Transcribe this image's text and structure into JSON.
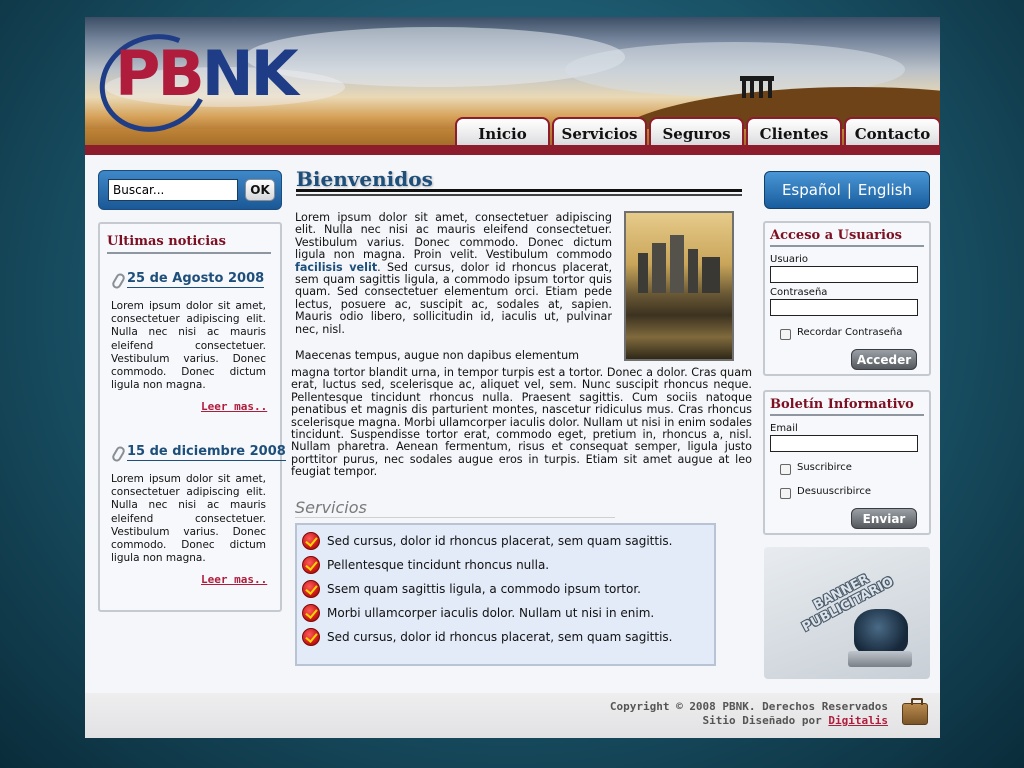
{
  "logo": {
    "text_p": "P",
    "text_b": "B",
    "text_n": "N",
    "text_k": "K"
  },
  "nav": [
    {
      "label": "Inicio"
    },
    {
      "label": "Servicios"
    },
    {
      "label": "Seguros"
    },
    {
      "label": "Clientes"
    },
    {
      "label": "Contacto"
    }
  ],
  "search": {
    "placeholder": "Buscar...",
    "value": "Buscar...",
    "button": "OK"
  },
  "news": {
    "title": "Ultimas noticias",
    "items": [
      {
        "date": "25 de Agosto 2008",
        "text": "Lorem ipsum dolor sit amet, consectetuer adipiscing elit. Nulla nec nisi ac mauris eleifend consectetuer. Vestibulum varius. Donec commodo. Donec dictum ligula non magna.",
        "more": "Leer mas.."
      },
      {
        "date": "15 de diciembre 2008",
        "text": "Lorem ipsum dolor sit amet, consectetuer adipiscing elit. Nulla nec nisi ac mauris eleifend consectetuer. Vestibulum varius. Donec commodo. Donec dictum ligula non magna.",
        "more": "Leer mas.."
      }
    ]
  },
  "main": {
    "title": "Bienvenidos",
    "para1_a": "Lorem ipsum dolor sit amet, consectetuer adipiscing elit. Nulla nec nisi ac mauris eleifend consectetuer. Vestibulum varius. Donec commodo. Donec dictum ligula non magna. Proin velit. Vestibulum commodo ",
    "para1_link": "facilisis velit",
    "para1_b": ". Sed cursus, dolor id rhoncus placerat, sem quam sagittis ligula, a commodo ipsum tortor quis quam. Sed consectetuer elementum orci. Etiam pede lectus, posuere ac, suscipit ac, sodales at, sapien. Mauris odio libero, sollicitudin id, iaculis ut, pulvinar nec, nisl.",
    "para2_a": "Maecenas tempus, augue non dapibus elementum",
    "para2_b": "magna tortor blandit urna, in tempor turpis est a tortor. Donec a dolor. Cras quam erat, luctus sed, scelerisque ac, aliquet vel, sem. Nunc suscipit rhoncus neque. Pellentesque tincidunt rhoncus nulla. Praesent sagittis. Cum sociis natoque penatibus et magnis dis parturient montes, nascetur ridiculus mus. Cras rhoncus scelerisque magna. Morbi ullamcorper iaculis dolor. Nullam ut nisi in enim sodales tincidunt. Suspendisse tortor erat, commodo eget, pretium in, rhoncus a, nisl. Nullam pharetra. Aenean fermentum, risus et consequat semper, ligula justo porttitor purus, nec sodales augue eros in turpis. Etiam sit amet augue at leo feugiat tempor.",
    "services_title": "Servicios",
    "services": [
      "Sed cursus, dolor id rhoncus placerat, sem quam sagittis.",
      "Pellentesque tincidunt rhoncus nulla.",
      "Ssem quam sagittis ligula, a commodo ipsum tortor.",
      "Morbi ullamcorper iaculis dolor. Nullam ut nisi in enim.",
      "Sed cursus, dolor id rhoncus placerat, sem quam sagittis."
    ]
  },
  "lang": {
    "es": "Español",
    "sep": "|",
    "en": "English"
  },
  "login": {
    "title": "Acceso a Usuarios",
    "user_label": "Usuario",
    "pass_label": "Contraseña",
    "remember": "Recordar Contraseña",
    "button": "Acceder"
  },
  "newsletter": {
    "title": "Boletín Informativo",
    "email_label": "Email",
    "subscribe": "Suscribirce",
    "unsubscribe": "Desuuscribirce",
    "button": "Enviar"
  },
  "banner": {
    "line1": "BANNER",
    "line2": "PUBLICITARIO"
  },
  "footer": {
    "copyright": "Copyright ©  2008 PBNK. Derechos Reservados",
    "designed_by": "Sitio Diseñado por ",
    "designer": "Digitalis"
  },
  "colors": {
    "brand_red": "#8d1c2c",
    "brand_blue": "#1e4f7b",
    "accent_blue": "#185d9d"
  }
}
